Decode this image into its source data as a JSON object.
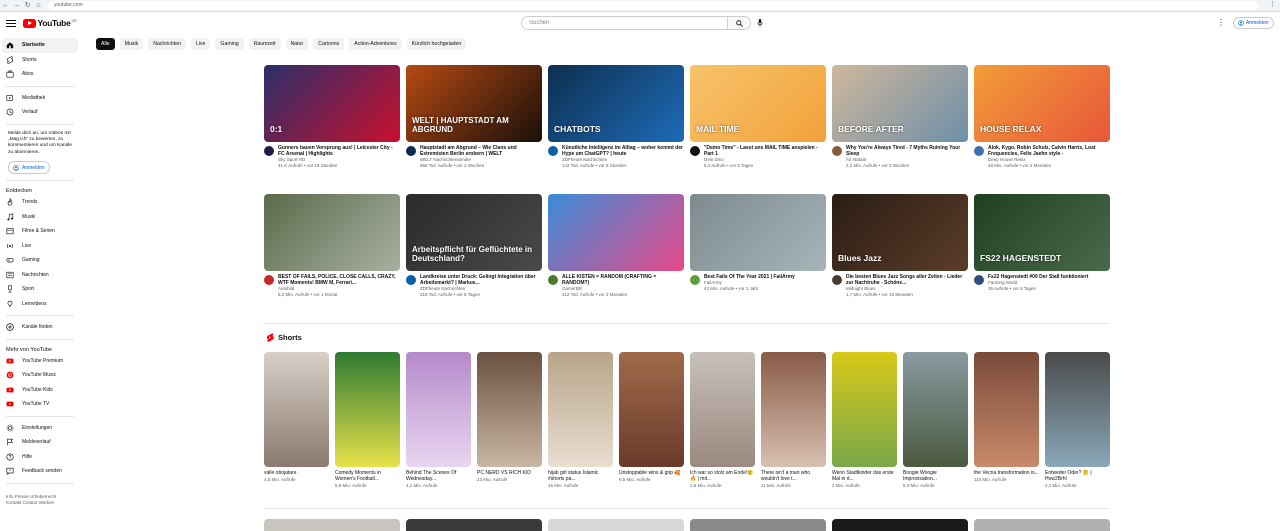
{
  "browser": {
    "url": "youtube.com"
  },
  "masthead": {
    "logo_text": "YouTube",
    "logo_country": "DE",
    "search_placeholder": "Suchen",
    "signin_label": "Anmelden"
  },
  "sidebar": {
    "primary": [
      {
        "label": "Startseite",
        "icon": "home-icon"
      },
      {
        "label": "Shorts",
        "icon": "shorts-icon"
      },
      {
        "label": "Abos",
        "icon": "subscriptions-icon"
      }
    ],
    "library": [
      {
        "label": "Mediathek",
        "icon": "library-icon"
      },
      {
        "label": "Verlauf",
        "icon": "history-icon"
      }
    ],
    "signin_message": "Melde dich an, um Videos mit „Mag ich“ zu bewerten, zu kommentieren und um Kanäle zu abonnieren.",
    "signin_label": "Anmelden",
    "explore_heading": "Entdecken",
    "explore": [
      {
        "label": "Trends",
        "icon": "trending-icon"
      },
      {
        "label": "Musik",
        "icon": "music-icon"
      },
      {
        "label": "Filme & Serien",
        "icon": "movies-icon"
      },
      {
        "label": "Live",
        "icon": "live-icon"
      },
      {
        "label": "Gaming",
        "icon": "gaming-icon"
      },
      {
        "label": "Nachrichten",
        "icon": "news-icon"
      },
      {
        "label": "Sport",
        "icon": "sport-icon"
      },
      {
        "label": "Lernvideos",
        "icon": "learning-icon"
      }
    ],
    "browse_channels": "Kanäle finden",
    "more_heading": "Mehr von YouTube",
    "more": [
      {
        "label": "YouTube Premium",
        "icon": "youtube-premium-icon"
      },
      {
        "label": "YouTube Music",
        "icon": "youtube-music-icon"
      },
      {
        "label": "YouTube Kids",
        "icon": "youtube-kids-icon"
      },
      {
        "label": "YouTube TV",
        "icon": "youtube-tv-icon"
      }
    ],
    "settings": [
      {
        "label": "Einstellungen",
        "icon": "settings-icon"
      },
      {
        "label": "Meldeverlauf",
        "icon": "flag-icon"
      },
      {
        "label": "Hilfe",
        "icon": "help-icon"
      },
      {
        "label": "Feedback senden",
        "icon": "feedback-icon"
      }
    ],
    "footer_line1": "Info  Presse  Urheberrecht",
    "footer_line2": "Kontakt  Creator  Werben"
  },
  "chips": [
    "Alle",
    "Musik",
    "Nachrichten",
    "Live",
    "Gaming",
    "Raumzeit",
    "Natur",
    "Cartoons",
    "Action-Adventures",
    "Kürzlich hochgeladen"
  ],
  "videos_row1": [
    {
      "title": "Gunners bauen Vorsprung aus! | Leicester City - FC Arsenal | Highlights",
      "channel": "Sky Sport HD",
      "stats": "41 K Aufrufe • vor 18 Stunden",
      "avatar_color": "#1b1f4a",
      "thumb_a": "#2b2f6b",
      "thumb_b": "#c8102e",
      "overlay": "0:1"
    },
    {
      "title": "Hauptstadt am Abgrund – Wie Clans und Extremisten Berlin erobern | WELT",
      "channel": "WELT Nachrichtensender",
      "stats": "656 Tsd. Aufrufe • vor 2 Wochen",
      "avatar_color": "#0c2a57",
      "thumb_a": "#b54a12",
      "thumb_b": "#1a0f0a",
      "overlay": "WELT | HAUPTSTADT AM ABGRUND"
    },
    {
      "title": "Künstliche Intelligenz im Alltag – woher kommt der Hype um ChatGPT? | heute",
      "channel": "ZDFheute Nachrichten",
      "stats": "142 Tsd. Aufrufe • vor 5 Stunden",
      "avatar_color": "#0b5fa5",
      "thumb_a": "#0d2f4f",
      "thumb_b": "#1e6bb8",
      "overlay": "CHATBOTS"
    },
    {
      "title": "\"Demo Time\" - Lasst uns MAIL TIME anspielen - Part 1",
      "channel": "Dein Dino",
      "stats": "5,4 Aufrufe • vor 5 Tagen",
      "avatar_color": "#111111",
      "thumb_a": "#f7c36a",
      "thumb_b": "#f2a13a",
      "overlay": "MAIL TIME"
    },
    {
      "title": "Why You're Always Tired - 7 Myths Ruining Your Sleep",
      "channel": "Ali Abdaal",
      "stats": "2,2 Mio. Aufrufe • vor 2 Wochen",
      "avatar_color": "#8a5a3b",
      "thumb_a": "#cfb79c",
      "thumb_b": "#6e8fa8",
      "overlay": "BEFORE      AFTER"
    },
    {
      "title": "Alok, Kygo, Robin Schulz, Calvin Harris, Lost Frequencies, Felix Jaehn style -",
      "channel": "Deep House Relax",
      "stats": "48 Mio. Aufrufe • vor 2 Monaten",
      "avatar_color": "#3b6fb0",
      "thumb_a": "#f29d38",
      "thumb_b": "#e8563a",
      "overlay": "HOUSE   RELAX"
    }
  ],
  "videos_row2": [
    {
      "title": "BEST OF FAILS, POLICE, CLOSE CALLS, CRAZY, WTF Moments! BMW M, Ferrari...",
      "channel": "Autobild",
      "stats": "5,2 Mio. Aufrufe • vor 1 Monat",
      "avatar_color": "#c62828",
      "thumb_a": "#5a6b4a",
      "thumb_b": "#a8b0a0",
      "overlay": ""
    },
    {
      "title": "Landkreise unter Druck: Gelingt Integration über Arbeitsmarkt? | Markus...",
      "channel": "ZDFheute Nachrichten",
      "stats": "218 Tsd. Aufrufe • vor 5 Tagen",
      "avatar_color": "#0b5fa5",
      "thumb_a": "#2a2a2a",
      "thumb_b": "#4a4a4a",
      "overlay": "Arbeitspflicht für Geflüchtete in Deutschland?"
    },
    {
      "title": "ALLE KISTEN = RANDOM (CRAFTING = RANDOM?)",
      "channel": "GamerBR",
      "stats": "412 Tsd. Aufrufe • vor 2 Monaten",
      "avatar_color": "#4c7a2d",
      "thumb_a": "#3a8cd8",
      "thumb_b": "#e84a8a",
      "overlay": ""
    },
    {
      "title": "Best Fails Of The Year 2021 | FailArmy",
      "channel": "FailArmy",
      "stats": "43 Mio. Aufrufe • vor 1 Jahr",
      "avatar_color": "#5aa03c",
      "thumb_a": "#7d8a8f",
      "thumb_b": "#a7b4b8",
      "overlay": ""
    },
    {
      "title": "Die besten Blues Jazz Songs aller Zeiten - Lieder zur Nachtruhe - Schöne...",
      "channel": "Midnight Blues",
      "stats": "1,7 Mio. Aufrufe • vor 10 Monaten",
      "avatar_color": "#4a3b30",
      "thumb_a": "#2b1d14",
      "thumb_b": "#5a3d28",
      "overlay": "Blues Jazz"
    },
    {
      "title": "Fs22 Hagenstedt #09 Der Stall funktioniert",
      "channel": "Farming World",
      "stats": "35 Aufrufe • vor 5 Tagen",
      "avatar_color": "#2f4f7f",
      "thumb_a": "#1f3f1f",
      "thumb_b": "#4a6b4a",
      "overlay": "FS22 HAGENSTEDT"
    }
  ],
  "shorts_heading": "Shorts",
  "shorts": [
    {
      "title": "valle obojatare",
      "views": "4,5 Mio. Aufrufe",
      "color_a": "#d8d0c8",
      "color_b": "#8a7a70"
    },
    {
      "title": "Comedy Moments in Women's Football...",
      "views": "5,8 Mio. Aufrufe",
      "color_a": "#2f7a32",
      "color_b": "#e7e24a"
    },
    {
      "title": "Behind The Scenes Of Wednesday...",
      "views": "4,1 Mio. Aufrufe",
      "color_a": "#b58acb",
      "color_b": "#e8d6f0"
    },
    {
      "title": "PC NERD VS RICH KID",
      "views": "23 Mio. Aufrufe",
      "color_a": "#6b5040",
      "color_b": "#c9b7a5"
    },
    {
      "title": "hijab girl status Islamic #shorts pa...",
      "views": "16 Mio. Aufrufe",
      "color_a": "#b8a48a",
      "color_b": "#e8ded0"
    },
    {
      "title": "Unstoppable wins & grip 🥰",
      "views": "9,5 Mio. Aufrufe",
      "color_a": "#a06a4a",
      "color_b": "#6b3a2a"
    },
    {
      "title": "Ich war so stolz am Ende!😢🔥 | mit...",
      "views": "1,6 Mio. Aufrufe",
      "color_a": "#c8c0b8",
      "color_b": "#9a8a80"
    },
    {
      "title": "There isn't a man who wouldn't love t...",
      "views": "11 Mio. Aufrufe",
      "color_a": "#8a5a48",
      "color_b": "#d8c0b0"
    },
    {
      "title": "Wenn Stadtkinder das erste Mal in d...",
      "views": "2 Mio. Aufrufe",
      "color_a": "#d8c818",
      "color_b": "#7aa84a"
    },
    {
      "title": "Boogie Woogie Improvisation...",
      "views": "5,3 Mio. Aufrufe",
      "color_a": "#8a9aa0",
      "color_b": "#4a5a40"
    },
    {
      "title": "the Vecna transformation is...",
      "views": "110 Mio. Aufrufe",
      "color_a": "#7a4a3a",
      "color_b": "#c88a6a"
    },
    {
      "title": "Entweder Oder? 🤔 | How2Brhl",
      "views": "2,1 Mio. Aufrufe",
      "color_a": "#4a4a4a",
      "color_b": "#8aa8b8"
    }
  ],
  "colors": {
    "brand_red": "#ff0000",
    "link_blue": "#065fd4"
  }
}
